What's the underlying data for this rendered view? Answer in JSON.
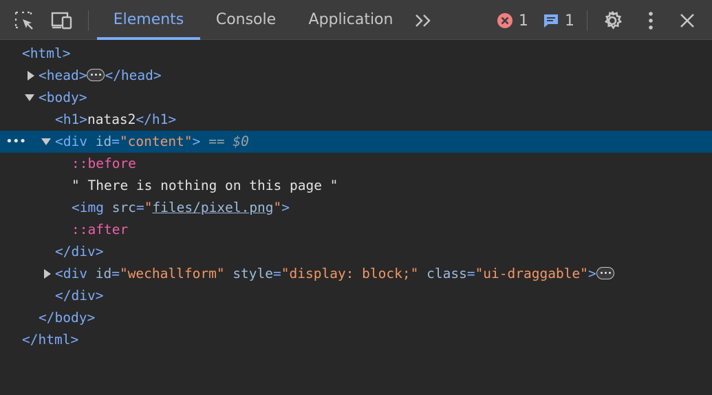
{
  "toolbar": {
    "tabs": [
      "Elements",
      "Console",
      "Application"
    ],
    "more_tabs_label": ">>",
    "error_count": "1",
    "message_count": "1"
  },
  "tree": {
    "html_open": "<html>",
    "head_open": "<head>",
    "head_close": "</head>",
    "body_open": "<body>",
    "h1_open": "<h1>",
    "h1_text": "natas2",
    "h1_close": "</h1>",
    "div_open": "<div ",
    "attr_id": "id",
    "eq": "=",
    "content_val": "\"content\"",
    "gt": ">",
    "selected_marker": "== $0",
    "before": "::before",
    "text_node": "\" There is nothing on this page \"",
    "img_open": "<img ",
    "attr_src": "src",
    "quote": "\"",
    "src_val": "files/pixel.png",
    "after": "::after",
    "div_close": "</div>",
    "wechall_val": "\"wechallform\"",
    "attr_style": "style",
    "style_val": "\"display: block;\"",
    "attr_class": "class",
    "class_val": "\"ui-draggable\"",
    "body_close": "</body>",
    "html_close": "</html>",
    "row_dots": "•••"
  }
}
